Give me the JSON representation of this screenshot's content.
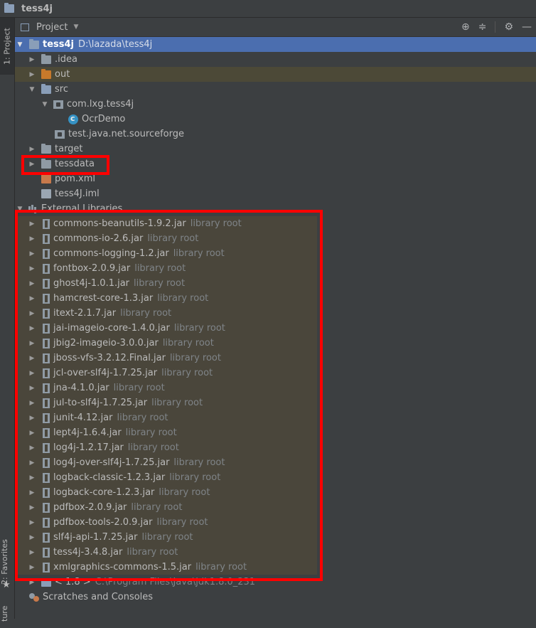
{
  "window_title": "tess4j",
  "left_strip": {
    "project_tab": "1: Project",
    "favorites_tab": "2: Favorites",
    "structure_tab": "ture"
  },
  "panel": {
    "view_label": "Project",
    "icons": [
      "locate-icon",
      "collapse-icon",
      "gear-icon",
      "minimize-icon"
    ]
  },
  "tree": {
    "root": {
      "name": "tess4j",
      "path": "D:\\lazada\\tess4j"
    },
    "idea": ".idea",
    "out": "out",
    "src": "src",
    "pkg": "com.lxg.tess4j",
    "ocr": "OcrDemo",
    "test_pkg": "test.java.net.sourceforge",
    "target": "target",
    "tessdata": "tessdata",
    "pom": "pom.xml",
    "iml": "tess4J.iml",
    "external": "External Libraries",
    "libraries": [
      {
        "name": "commons-beanutils-1.9.2.jar",
        "hint": "library root"
      },
      {
        "name": "commons-io-2.6.jar",
        "hint": "library root"
      },
      {
        "name": "commons-logging-1.2.jar",
        "hint": "library root"
      },
      {
        "name": "fontbox-2.0.9.jar",
        "hint": "library root"
      },
      {
        "name": "ghost4j-1.0.1.jar",
        "hint": "library root"
      },
      {
        "name": "hamcrest-core-1.3.jar",
        "hint": "library root"
      },
      {
        "name": "itext-2.1.7.jar",
        "hint": "library root"
      },
      {
        "name": "jai-imageio-core-1.4.0.jar",
        "hint": "library root"
      },
      {
        "name": "jbig2-imageio-3.0.0.jar",
        "hint": "library root"
      },
      {
        "name": "jboss-vfs-3.2.12.Final.jar",
        "hint": "library root"
      },
      {
        "name": "jcl-over-slf4j-1.7.25.jar",
        "hint": "library root"
      },
      {
        "name": "jna-4.1.0.jar",
        "hint": "library root"
      },
      {
        "name": "jul-to-slf4j-1.7.25.jar",
        "hint": "library root"
      },
      {
        "name": "junit-4.12.jar",
        "hint": "library root"
      },
      {
        "name": "lept4j-1.6.4.jar",
        "hint": "library root"
      },
      {
        "name": "log4j-1.2.17.jar",
        "hint": "library root"
      },
      {
        "name": "log4j-over-slf4j-1.7.25.jar",
        "hint": "library root"
      },
      {
        "name": "logback-classic-1.2.3.jar",
        "hint": "library root"
      },
      {
        "name": "logback-core-1.2.3.jar",
        "hint": "library root"
      },
      {
        "name": "pdfbox-2.0.9.jar",
        "hint": "library root"
      },
      {
        "name": "pdfbox-tools-2.0.9.jar",
        "hint": "library root"
      },
      {
        "name": "slf4j-api-1.7.25.jar",
        "hint": "library root"
      },
      {
        "name": "tess4j-3.4.8.jar",
        "hint": "library root"
      },
      {
        "name": "xmlgraphics-commons-1.5.jar",
        "hint": "library root"
      }
    ],
    "jdk": {
      "name": "< 1.8 >",
      "path": "C:\\Program Files\\Java\\jdk1.8.0_231"
    },
    "scratches": "Scratches and Consoles"
  },
  "colors": {
    "selection": "#4b6eaf",
    "excluded": "#4c4937",
    "highlight": "#ff0000"
  }
}
